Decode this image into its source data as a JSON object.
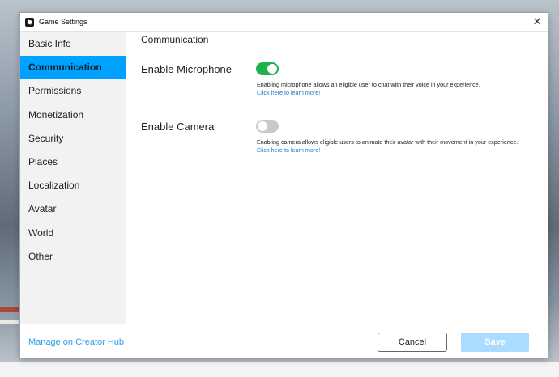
{
  "window": {
    "title": "Game Settings",
    "close_glyph": "✕"
  },
  "sidebar": {
    "items": [
      {
        "label": "Basic Info"
      },
      {
        "label": "Communication"
      },
      {
        "label": "Permissions"
      },
      {
        "label": "Monetization"
      },
      {
        "label": "Security"
      },
      {
        "label": "Places"
      },
      {
        "label": "Localization"
      },
      {
        "label": "Avatar"
      },
      {
        "label": "World"
      },
      {
        "label": "Other"
      }
    ],
    "active_index": 1
  },
  "main": {
    "section_title": "Communication",
    "settings": [
      {
        "label": "Enable Microphone",
        "enabled": true,
        "description": "Enabling microphone allows an eligible user to chat with their voice in your experience.",
        "link": "Click here to learn more!"
      },
      {
        "label": "Enable Camera",
        "enabled": false,
        "description": "Enabling camera allows eligible users to animate their avatar with their movement in your experience.",
        "link": "Click here to learn more!"
      }
    ]
  },
  "footer": {
    "creator_hub_link": "Manage on Creator Hub",
    "cancel_label": "Cancel",
    "save_label": "Save"
  },
  "colors": {
    "accent": "#00a2ff",
    "toggle_on": "#1fb14b",
    "toggle_off": "#c9c9c9",
    "link": "#1a73c9",
    "save_disabled": "#a9dcff"
  }
}
